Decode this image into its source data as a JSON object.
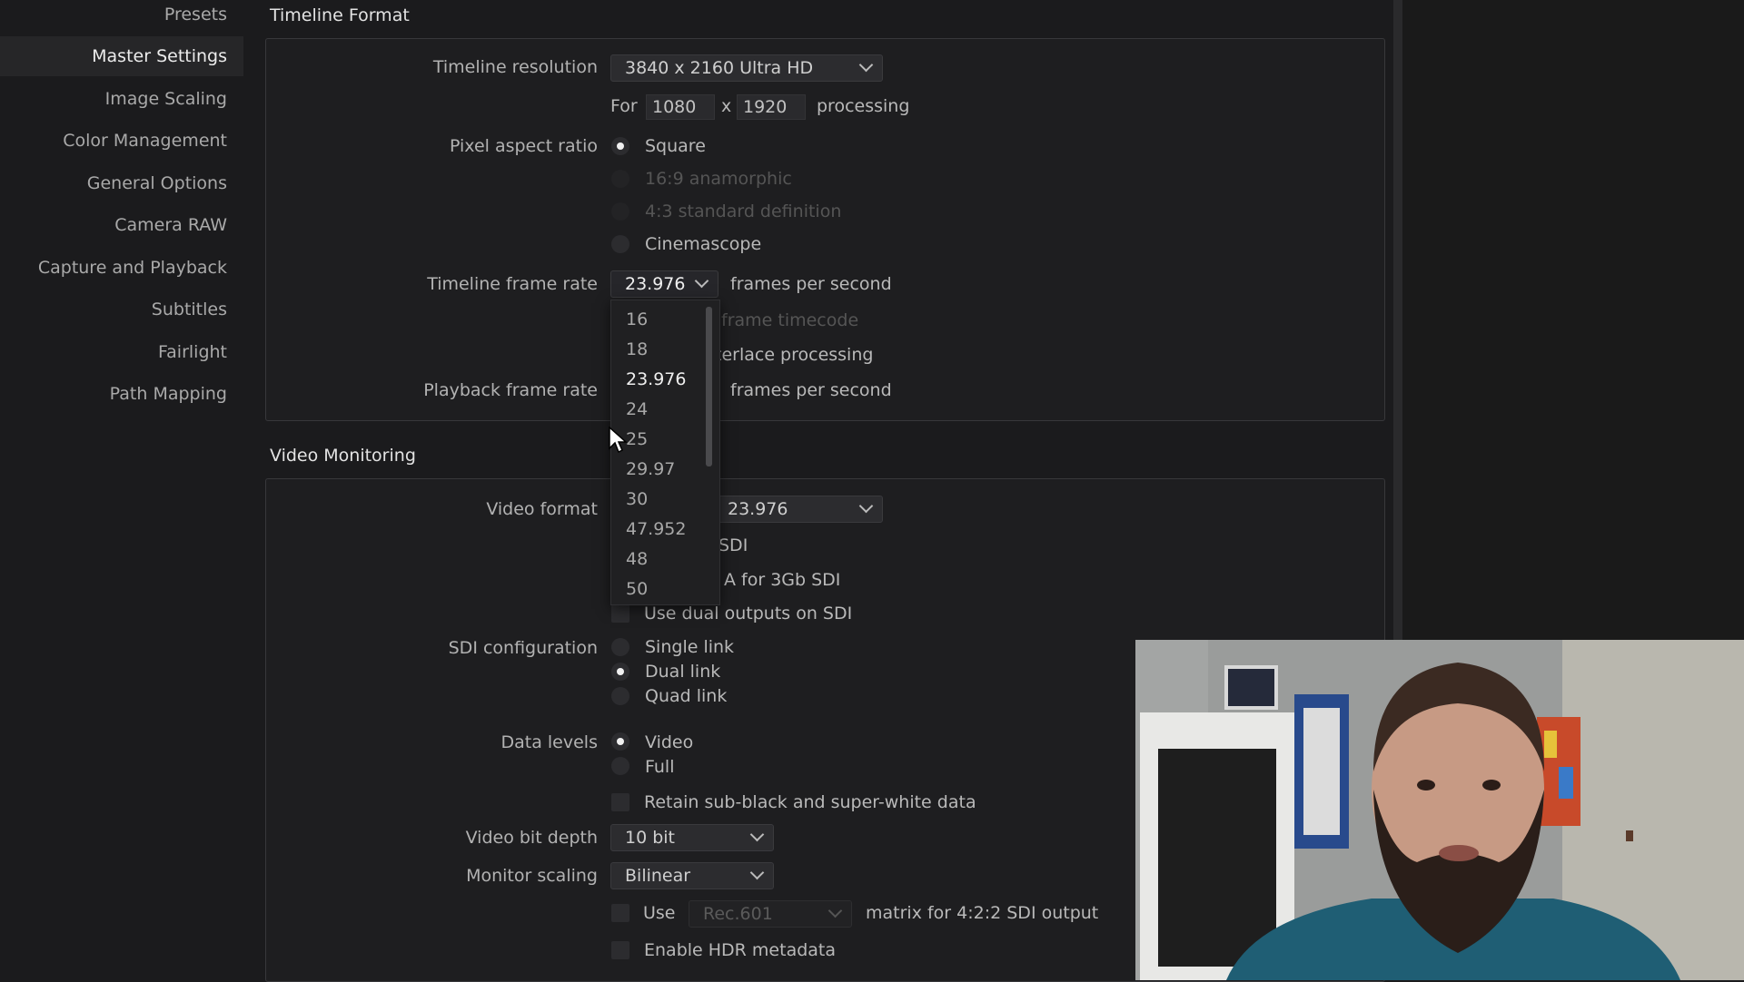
{
  "sidebar": {
    "items": [
      {
        "label": "Presets"
      },
      {
        "label": "Master Settings"
      },
      {
        "label": "Image Scaling"
      },
      {
        "label": "Color Management"
      },
      {
        "label": "General Options"
      },
      {
        "label": "Camera RAW"
      },
      {
        "label": "Capture and Playback"
      },
      {
        "label": "Subtitles"
      },
      {
        "label": "Fairlight"
      },
      {
        "label": "Path Mapping"
      }
    ]
  },
  "timeline_format": {
    "title": "Timeline Format",
    "resolution_label": "Timeline resolution",
    "resolution_value": "3840 x 2160 Ultra HD",
    "for_label": "For",
    "width": "1080",
    "x_label": "x",
    "height": "1920",
    "processing_label": "processing",
    "pixel_aspect_label": "Pixel aspect ratio",
    "aspect_options": [
      {
        "label": "Square"
      },
      {
        "label": "16:9 anamorphic"
      },
      {
        "label": "4:3 standard definition"
      },
      {
        "label": "Cinemascope"
      }
    ],
    "frame_rate_label": "Timeline frame rate",
    "frame_rate_value": "23.976",
    "fps_suffix": "frames per second",
    "drop_frame_partial": "frame timecode",
    "interlace_partial": "terlace processing",
    "playback_label": "Playback frame rate",
    "playback_fps_suffix": "frames per second",
    "frame_rate_options": [
      "16",
      "18",
      "23.976",
      "24",
      "25",
      "29.97",
      "30",
      "47.952",
      "48",
      "50"
    ]
  },
  "video_monitoring": {
    "title": "Video Monitoring",
    "format_label": "Video format",
    "format_value_partial": "23.976",
    "sdi_partial_1": "SDI",
    "sdi_partial_2": "A for 3Gb SDI",
    "dual_outputs": "Use dual outputs on SDI",
    "sdi_config_label": "SDI configuration",
    "sdi_options": [
      {
        "label": "Single link"
      },
      {
        "label": "Dual link"
      },
      {
        "label": "Quad link"
      }
    ],
    "data_levels_label": "Data levels",
    "data_levels_options": [
      {
        "label": "Video"
      },
      {
        "label": "Full"
      }
    ],
    "retain_label": "Retain sub-black and super-white data",
    "bit_depth_label": "Video bit depth",
    "bit_depth_value": "10 bit",
    "monitor_scaling_label": "Monitor scaling",
    "monitor_scaling_value": "Bilinear",
    "use_label": "Use",
    "matrix_value": "Rec.601",
    "matrix_suffix": "matrix for 4:2:2 SDI output",
    "hdr_label": "Enable HDR metadata"
  },
  "colors": {
    "accent_text": "#ececec",
    "panel_bg": "#1e1e20",
    "app_bg": "#1b1b1d"
  }
}
